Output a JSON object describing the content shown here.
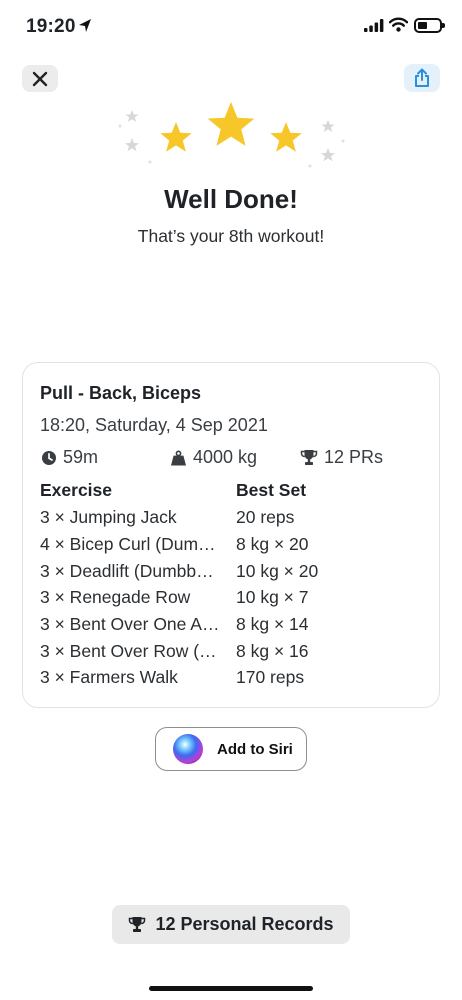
{
  "status_bar": {
    "time": "19:20"
  },
  "header": {
    "title": "Well Done!",
    "subtitle": "That’s your 8th workout!"
  },
  "workout": {
    "name": "Pull - Back, Biceps",
    "datetime": "18:20, Saturday, 4 Sep 2021",
    "duration": "59m",
    "volume": "4000 kg",
    "prs": "12 PRs",
    "columns": {
      "exercise": "Exercise",
      "best_set": "Best Set"
    },
    "exercises": [
      {
        "name": "3 × Jumping Jack",
        "best_set": "20 reps"
      },
      {
        "name": "4 × Bicep Curl (Dum…",
        "best_set": "8 kg × 20"
      },
      {
        "name": "3 × Deadlift (Dumbb…",
        "best_set": "10 kg × 20"
      },
      {
        "name": "3 × Renegade Row",
        "best_set": "10 kg × 7"
      },
      {
        "name": "3 × Bent Over One A…",
        "best_set": "8 kg × 14"
      },
      {
        "name": "3 × Bent Over Row (…",
        "best_set": "8 kg × 16"
      },
      {
        "name": "3 × Farmers Walk",
        "best_set": "170 reps"
      }
    ]
  },
  "siri": {
    "label": "Add to Siri"
  },
  "personal_records": {
    "label": "12 Personal Records"
  },
  "icons": {
    "close": "close-icon",
    "share": "share-icon",
    "clock": "clock-icon",
    "weight": "weight-icon",
    "trophy": "trophy-icon",
    "star": "star-icon"
  },
  "colors": {
    "star": "#f7c72a",
    "accent": "#2a8fdc"
  }
}
